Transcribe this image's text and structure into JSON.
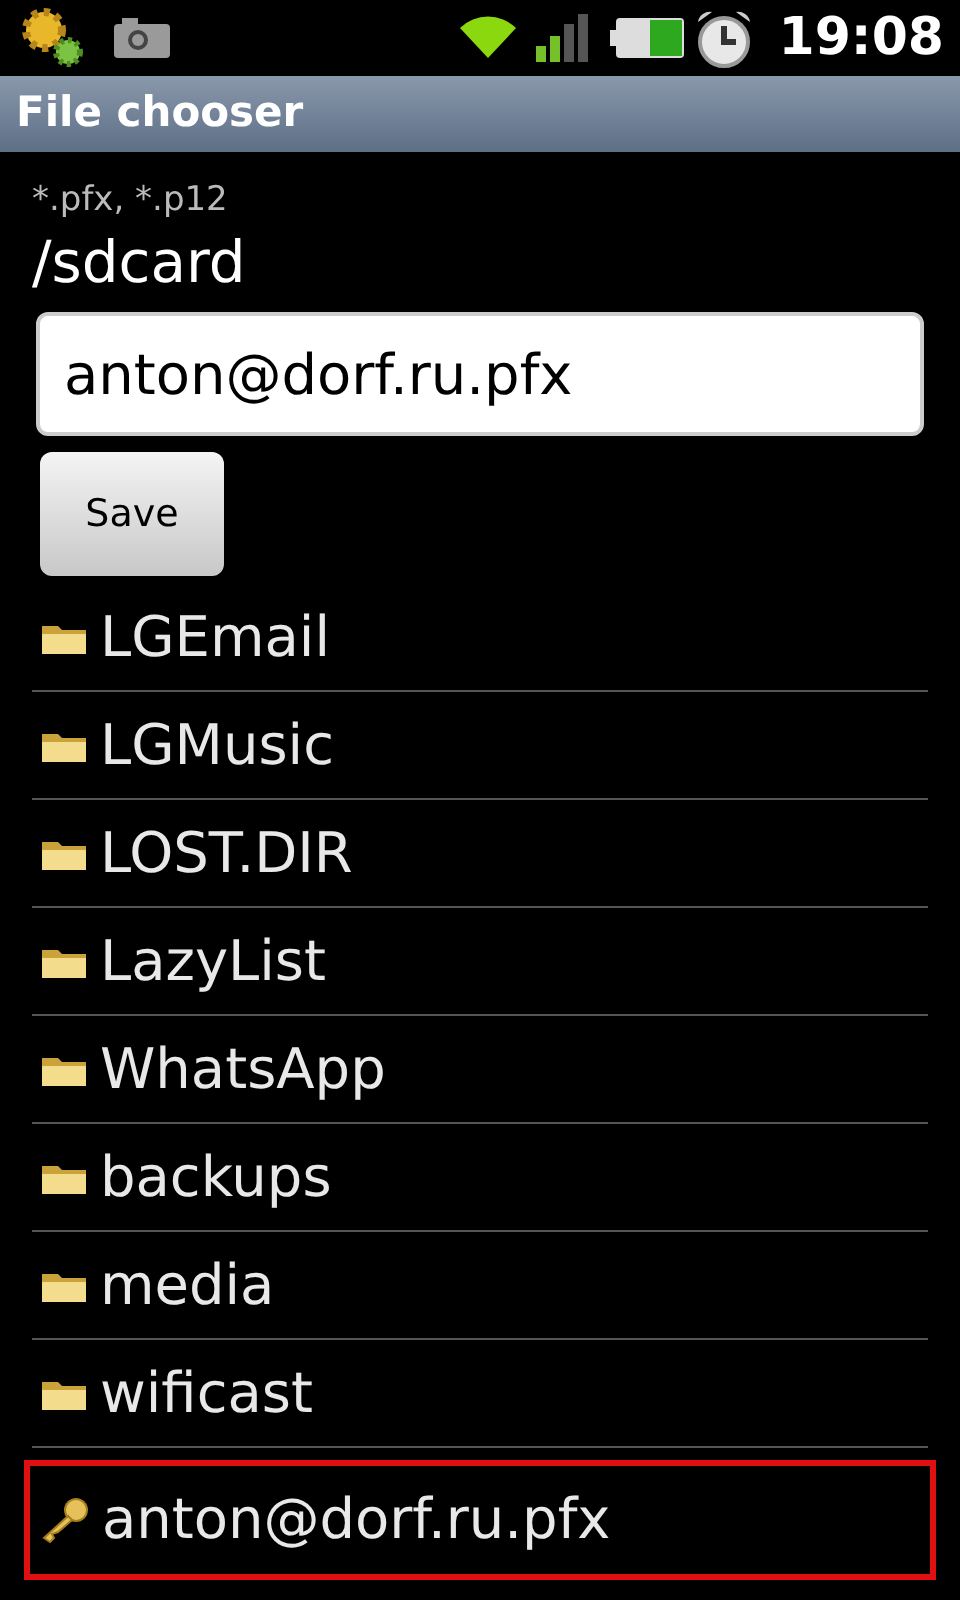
{
  "status_bar": {
    "time": "19:08"
  },
  "title_bar": {
    "title": "File chooser"
  },
  "filter": "*.pfx, *.p12",
  "path": "/sdcard",
  "filename_field": {
    "value": "anton@dorf.ru.pfx"
  },
  "save_button": "Save",
  "files": [
    {
      "name": "LGEmail",
      "kind": "folder",
      "highlighted": false
    },
    {
      "name": "LGMusic",
      "kind": "folder",
      "highlighted": false
    },
    {
      "name": "LOST.DIR",
      "kind": "folder",
      "highlighted": false
    },
    {
      "name": "LazyList",
      "kind": "folder",
      "highlighted": false
    },
    {
      "name": "WhatsApp",
      "kind": "folder",
      "highlighted": false
    },
    {
      "name": "backups",
      "kind": "folder",
      "highlighted": false
    },
    {
      "name": "media",
      "kind": "folder",
      "highlighted": false
    },
    {
      "name": "wificast",
      "kind": "folder",
      "highlighted": false
    },
    {
      "name": "anton@dorf.ru.pfx",
      "kind": "key",
      "highlighted": true
    }
  ]
}
